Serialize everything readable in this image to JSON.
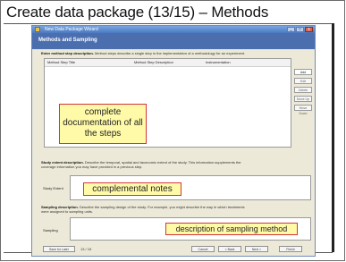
{
  "slide": {
    "title": "Create data package (13/15) – Methods"
  },
  "window": {
    "title": "New Data Package Wizard",
    "header": "Methods and Sampling",
    "controls": [
      "_",
      "□",
      "x"
    ]
  },
  "method_step": {
    "description_bold": "Enter method step description.",
    "description": " Method steps describe a single step in the implementation of a methodology for an experiment.",
    "columns": [
      "Method Step Title",
      "Method Step Description",
      "Instrumentation"
    ]
  },
  "side_buttons": [
    "Add",
    "Edit",
    "Delete",
    "Move Up",
    "Move Down"
  ],
  "study_extent": {
    "description_bold": "Study extent description.",
    "description_line1": " Describe the temporal, spatial and taxonomic extent of the study. This information supplements the",
    "description_line2": "coverage information you may have provided in a previous step.",
    "label": "Study Extent"
  },
  "sampling": {
    "description_bold": "Sampling description.",
    "description_line1": " Describe the sampling design of the study. For example, you might describe the way in which treatments",
    "description_line2": "were assigned to sampling units.",
    "label": "Sampling"
  },
  "annotations": {
    "steps": "complete documentation of all the steps",
    "notes": "complemental notes",
    "sampling": "description of sampling method"
  },
  "footer": {
    "save_label": "Save for Later",
    "page": "13 / 15",
    "cancel": "Cancel",
    "back": "< Back",
    "next": "Next >",
    "finish": "Finish"
  }
}
